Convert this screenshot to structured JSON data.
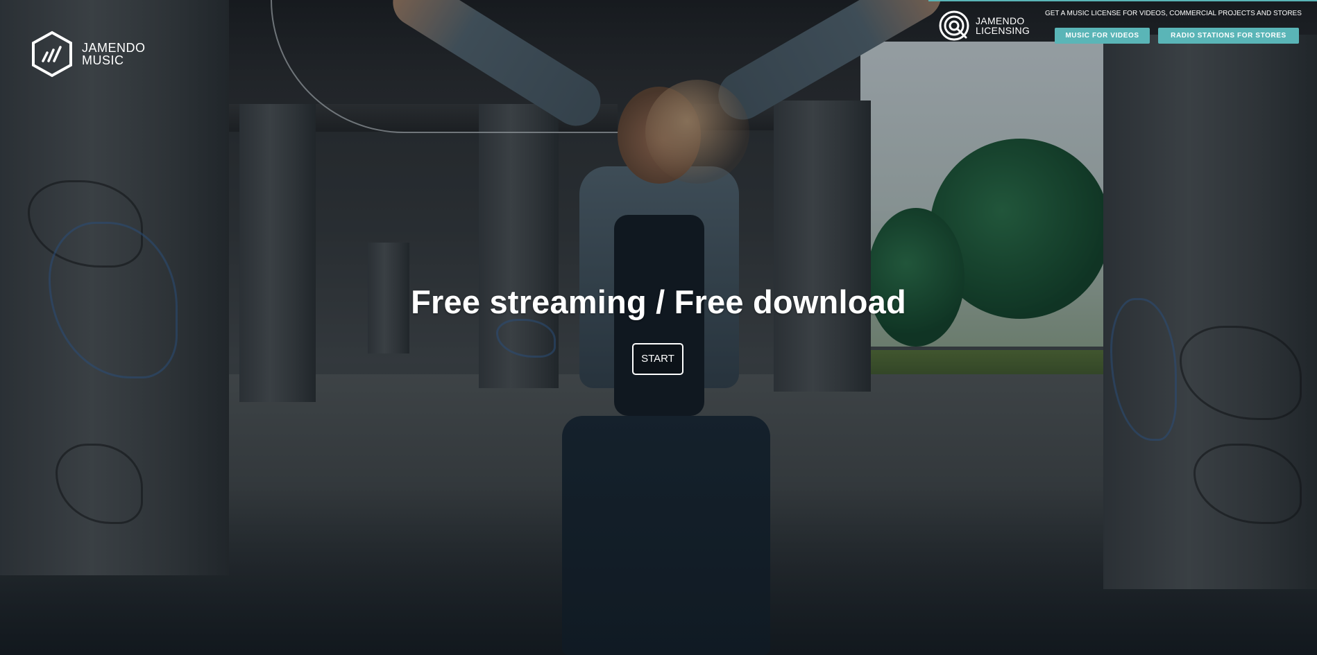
{
  "brand": {
    "name_line1": "JAMENDO",
    "name_line2": "MUSIC"
  },
  "licensing": {
    "name_line1": "JAMENDO",
    "name_line2": "LICENSING",
    "tagline": "GET A MUSIC LICENSE FOR VIDEOS, COMMERCIAL PROJECTS AND STORES",
    "buttons": [
      {
        "label": "MUSIC FOR VIDEOS"
      },
      {
        "label": "RADIO STATIONS FOR STORES"
      }
    ]
  },
  "hero": {
    "headline": "Free streaming / Free download",
    "cta_label": "START",
    "background_image": "woman-jumping-headphones-under-bridge"
  },
  "colors": {
    "accent": "#5ab5b7",
    "text": "#ffffff"
  }
}
